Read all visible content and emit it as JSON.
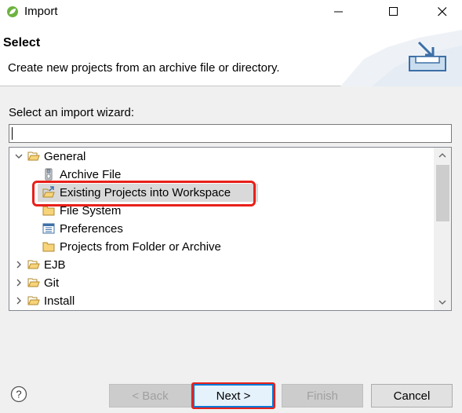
{
  "window": {
    "title": "Import",
    "minimize_glyph": "—",
    "maximize_glyph": "☐",
    "close_glyph": "✕"
  },
  "header": {
    "title": "Select",
    "description": "Create new projects from an archive file or directory."
  },
  "wizard": {
    "label": "Select an import wizard:",
    "filter_value": ""
  },
  "tree": {
    "items": [
      {
        "label": "General",
        "icon": "folder-open-icon",
        "expanded": true
      },
      {
        "label": "Archive File",
        "icon": "archive-file-icon"
      },
      {
        "label": "Existing Projects into Workspace",
        "icon": "existing-projects-icon",
        "selected": true
      },
      {
        "label": "File System",
        "icon": "folder-icon"
      },
      {
        "label": "Preferences",
        "icon": "preferences-icon"
      },
      {
        "label": "Projects from Folder or Archive",
        "icon": "folder-icon"
      },
      {
        "label": "EJB",
        "icon": "folder-icon",
        "expanded": false
      },
      {
        "label": "Git",
        "icon": "folder-icon",
        "expanded": false
      },
      {
        "label": "Install",
        "icon": "folder-icon",
        "expanded": false
      }
    ]
  },
  "buttons": {
    "back": "< Back",
    "next": "Next >",
    "finish": "Finish",
    "cancel": "Cancel"
  },
  "colors": {
    "annotation": "#e8201a",
    "focus": "#0078d7",
    "selection": "#d9d9d9"
  }
}
